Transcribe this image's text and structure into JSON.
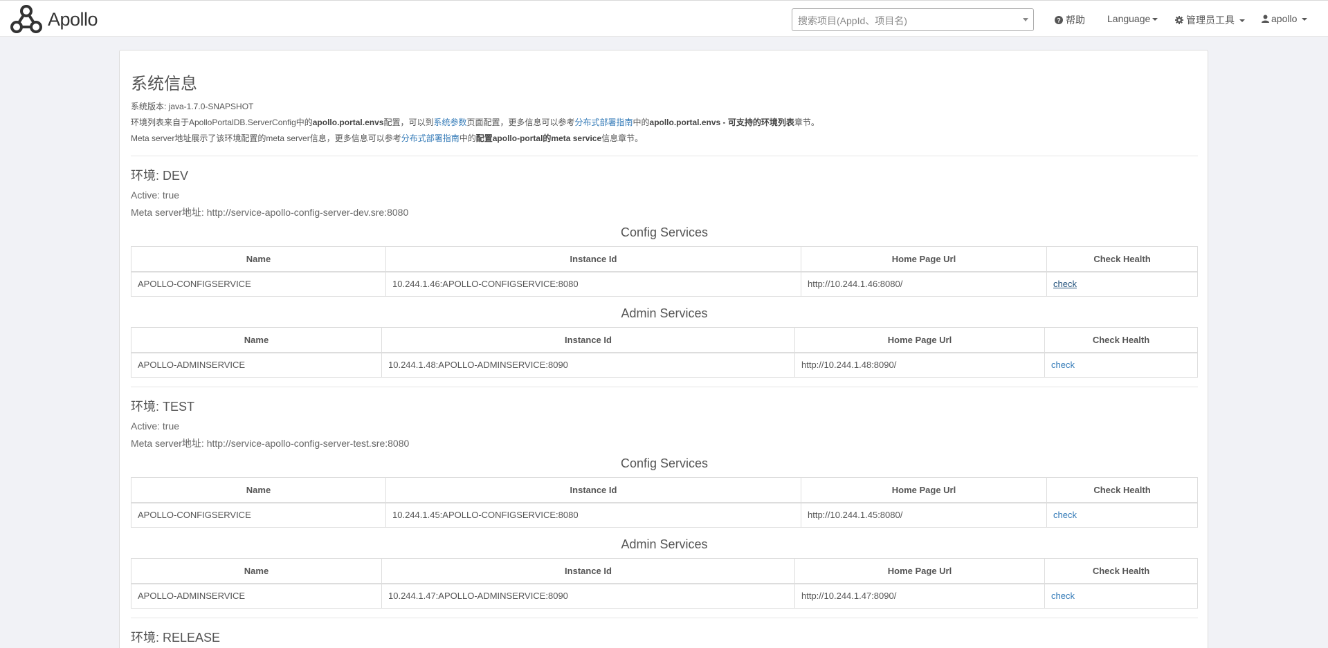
{
  "navbar": {
    "logo_text": "Apollo",
    "search_placeholder": "搜索项目(AppId、项目名)",
    "help_label": "帮助",
    "language_label": "Language",
    "admin_tools_label": "管理员工具",
    "user_label": "apollo"
  },
  "system_info": {
    "title": "系统信息",
    "version": "系统版本: java-1.7.0-SNAPSHOT",
    "env_list_line": {
      "t1": "环境列表来自于ApolloPortalDB.ServerConfig中的",
      "b1": "apollo.portal.envs",
      "t2": "配置，可以到",
      "link1": "系统参数",
      "t3": "页面配置，更多信息可以参考",
      "link2": "分布式部署指南",
      "t4": "中的",
      "b2": "apollo.portal.envs - 可支持的环境列表",
      "t5": "章节。"
    },
    "meta_line": {
      "t1": "Meta server地址展示了该环境配置的meta server信息，更多信息可以参考",
      "link1": "分布式部署指南",
      "t2": "中的",
      "b1": "配置apollo-portal的meta service",
      "t3": "信息章节。"
    }
  },
  "columns": [
    "Name",
    "Instance Id",
    "Home Page Url",
    "Check Health"
  ],
  "config_services_title": "Config Services",
  "admin_services_title": "Admin Services",
  "environments": [
    {
      "title": "环境: DEV",
      "active": "Active: true",
      "meta_server": "Meta server地址: http://service-apollo-config-server-dev.sre:8080",
      "config_services": [
        {
          "name": "APOLLO-CONFIGSERVICE",
          "instance_id": "10.244.1.46:APOLLO-CONFIGSERVICE:8080",
          "home_page_url": "http://10.244.1.46:8080/",
          "check": "check"
        }
      ],
      "admin_services": [
        {
          "name": "APOLLO-ADMINSERVICE",
          "instance_id": "10.244.1.48:APOLLO-ADMINSERVICE:8090",
          "home_page_url": "http://10.244.1.48:8090/",
          "check": "check"
        }
      ]
    },
    {
      "title": "环境: TEST",
      "active": "Active: true",
      "meta_server": "Meta server地址: http://service-apollo-config-server-test.sre:8080",
      "config_services": [
        {
          "name": "APOLLO-CONFIGSERVICE",
          "instance_id": "10.244.1.45:APOLLO-CONFIGSERVICE:8080",
          "home_page_url": "http://10.244.1.45:8080/",
          "check": "check"
        }
      ],
      "admin_services": [
        {
          "name": "APOLLO-ADMINSERVICE",
          "instance_id": "10.244.1.47:APOLLO-ADMINSERVICE:8090",
          "home_page_url": "http://10.244.1.47:8090/",
          "check": "check"
        }
      ]
    }
  ],
  "next_env_title": "环境: RELEASE"
}
